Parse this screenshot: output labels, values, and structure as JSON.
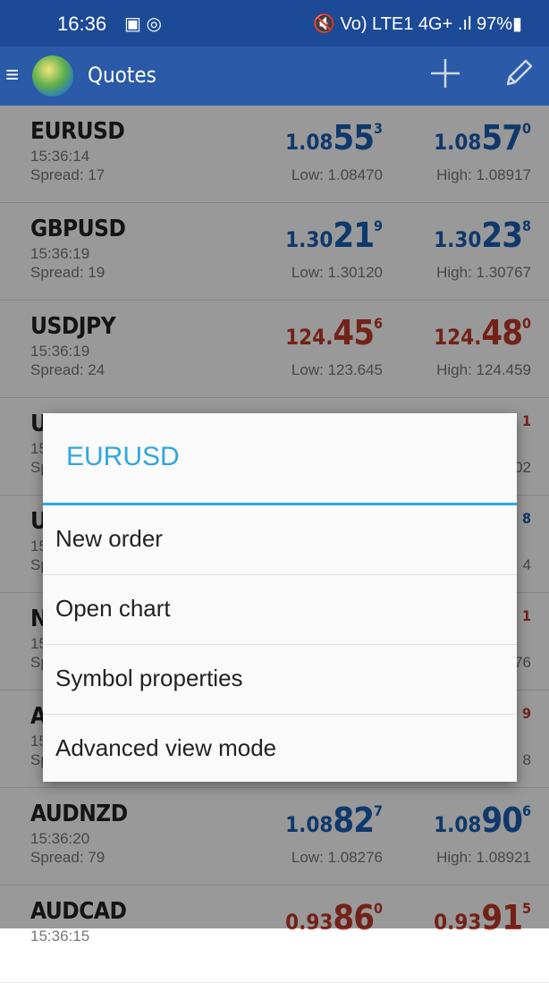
{
  "status_bar": {
    "time": "16:36",
    "left_icons": "▣ ◎",
    "right_text": "🔇 Vo) LTE1 4G+ .ıl 97%▮"
  },
  "app_bar": {
    "title": "Quotes"
  },
  "quotes": [
    {
      "symbol": "EURUSD",
      "time": "15:36:14",
      "spread": "Spread: 17",
      "bid": {
        "prefix": "1.08",
        "big": "55",
        "sup": "3"
      },
      "ask": {
        "prefix": "1.08",
        "big": "57",
        "sup": "0"
      },
      "low": "Low: 1.08470",
      "high": "High: 1.08917",
      "color": "#1a5fb4"
    },
    {
      "symbol": "GBPUSD",
      "time": "15:36:19",
      "spread": "Spread: 19",
      "bid": {
        "prefix": "1.30",
        "big": "21",
        "sup": "9"
      },
      "ask": {
        "prefix": "1.30",
        "big": "23",
        "sup": "8"
      },
      "low": "Low: 1.30120",
      "high": "High: 1.30767",
      "color": "#1a5fb4"
    },
    {
      "symbol": "USDJPY",
      "time": "15:36:19",
      "spread": "Spread: 24",
      "bid": {
        "prefix": "124.",
        "big": "45",
        "sup": "6"
      },
      "ask": {
        "prefix": "124.",
        "big": "48",
        "sup": "0"
      },
      "low": "Low: 123.645",
      "high": "High: 124.459",
      "color": "#c0392b"
    },
    {
      "symbol": "USDCAD",
      "time": "15",
      "spread": "Sp",
      "bid": {
        "prefix": "",
        "big": "",
        "sup": ""
      },
      "ask": {
        "prefix": "",
        "big": "",
        "sup": "1"
      },
      "low": "",
      "high": "02",
      "color": "#c0392b"
    },
    {
      "symbol": "U",
      "time": "15",
      "spread": "Sp",
      "bid": {
        "prefix": "",
        "big": "",
        "sup": ""
      },
      "ask": {
        "prefix": "",
        "big": "",
        "sup": "8"
      },
      "low": "",
      "high": "4",
      "color": "#1a5fb4"
    },
    {
      "symbol": "N",
      "time": "15",
      "spread": "Sp",
      "bid": {
        "prefix": "",
        "big": "",
        "sup": ""
      },
      "ask": {
        "prefix": "",
        "big": "",
        "sup": "1"
      },
      "low": "",
      "high": "76",
      "color": "#c0392b"
    },
    {
      "symbol": "A",
      "time": "15",
      "spread": "Sp",
      "bid": {
        "prefix": "",
        "big": "",
        "sup": ""
      },
      "ask": {
        "prefix": "",
        "big": "",
        "sup": "9"
      },
      "low": "",
      "high": "8",
      "color": "#c0392b"
    },
    {
      "symbol": "AUDNZD",
      "time": "15:36:20",
      "spread": "Spread: 79",
      "bid": {
        "prefix": "1.08",
        "big": "82",
        "sup": "7"
      },
      "ask": {
        "prefix": "1.08",
        "big": "90",
        "sup": "6"
      },
      "low": "Low: 1.08276",
      "high": "High: 1.08921",
      "color": "#1a5fb4"
    },
    {
      "symbol": "AUDCAD",
      "time": "15:36:15",
      "spread": "",
      "bid": {
        "prefix": "0.93",
        "big": "86",
        "sup": "0"
      },
      "ask": {
        "prefix": "0.93",
        "big": "91",
        "sup": "5"
      },
      "low": "",
      "high": "",
      "color": "#c0392b"
    }
  ],
  "dialog": {
    "title": "EURUSD",
    "items": [
      "New order",
      "Open chart",
      "Symbol properties",
      "Advanced view mode"
    ]
  }
}
